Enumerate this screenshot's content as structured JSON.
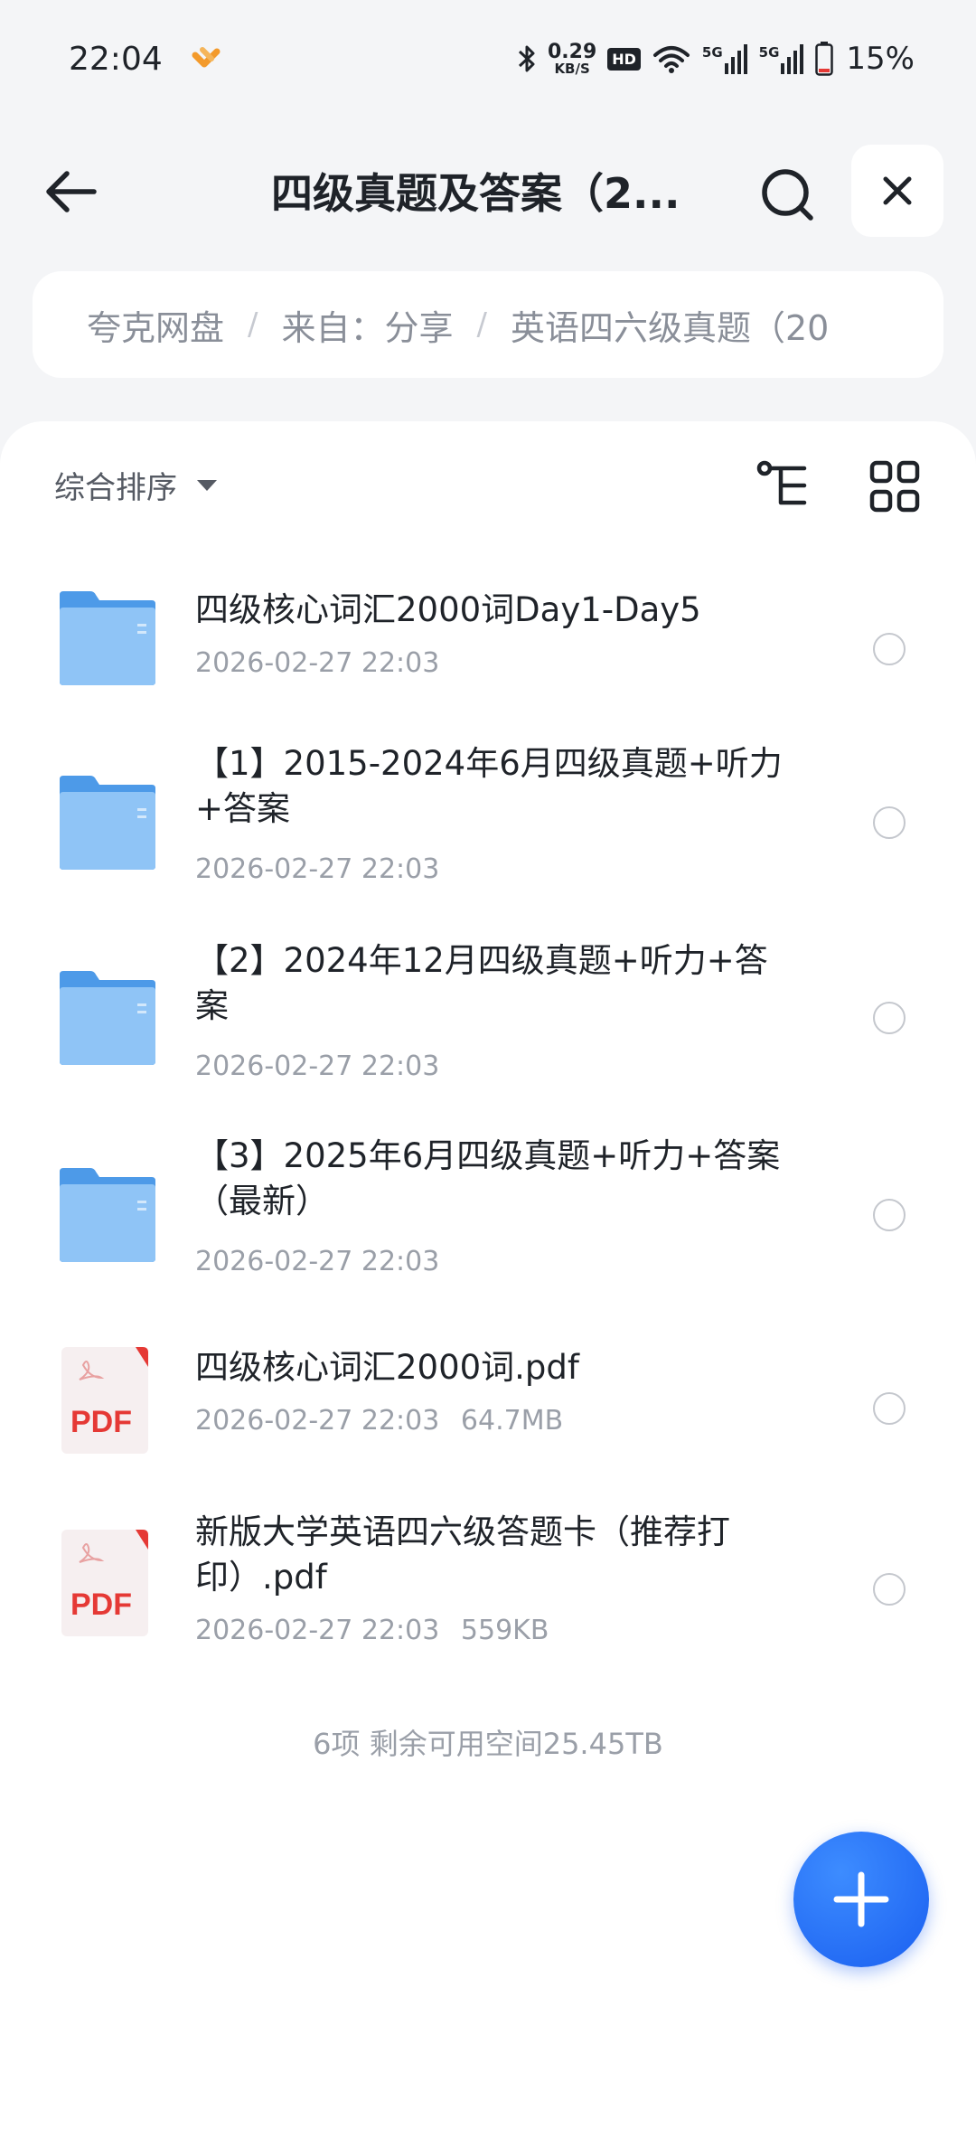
{
  "status_bar": {
    "time": "22:04",
    "speed_value": "0.29",
    "speed_unit": "KB/S",
    "hd": "HD",
    "net1": "5G",
    "net2": "5G",
    "battery": "15%"
  },
  "header": {
    "title": "四级真题及答案（2..."
  },
  "breadcrumb": {
    "items": [
      "夸克网盘",
      "来自：分享",
      "英语四六级真题（20"
    ]
  },
  "toolbar": {
    "sort_label": "综合排序"
  },
  "files": [
    {
      "type": "folder",
      "name": "四级核心词汇2000词Day1-Day5",
      "date": "2026-02-27 22:03",
      "size": ""
    },
    {
      "type": "folder",
      "name": "【1】2015-2024年6月四级真题+听力+答案",
      "date": "2026-02-27 22:03",
      "size": ""
    },
    {
      "type": "folder",
      "name": "【2】2024年12月四级真题+听力+答案",
      "date": "2026-02-27 22:03",
      "size": ""
    },
    {
      "type": "folder",
      "name": "【3】2025年6月四级真题+听力+答案（最新）",
      "date": "2026-02-27 22:03",
      "size": ""
    },
    {
      "type": "pdf",
      "name": "四级核心词汇2000词.pdf",
      "date": "2026-02-27 22:03",
      "size": "64.7MB"
    },
    {
      "type": "pdf",
      "name": "新版大学英语四六级答题卡（推荐打印）.pdf",
      "date": "2026-02-27 22:03",
      "size": "559KB"
    }
  ],
  "pdf_label": "PDF",
  "footer": {
    "summary": "6项 剩余可用空间25.45TB"
  },
  "colors": {
    "accent": "#1a5ff0",
    "folder": "#79b8f5",
    "pdf_red": "#e53935"
  },
  "icons": [
    "back-arrow-icon",
    "search-icon",
    "close-icon",
    "tree-view-icon",
    "grid-view-icon",
    "plus-icon"
  ]
}
